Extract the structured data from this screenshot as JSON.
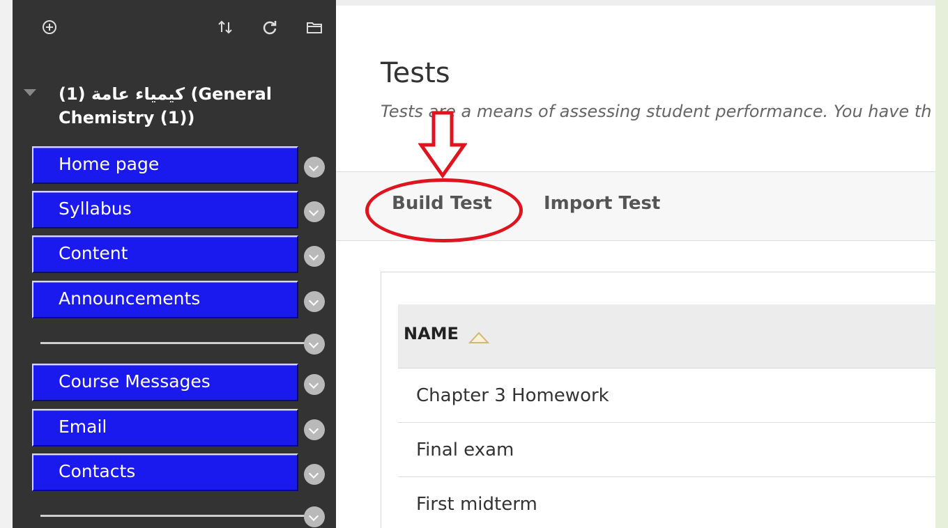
{
  "colors": {
    "sidebar_bg": "#333333",
    "nav_item_bg": "#1a1aee",
    "annotation_red": "#e0141e",
    "outer_bg": "#e6efd9"
  },
  "sidebar": {
    "toolbar_icons": [
      "add-circle-icon",
      "sort-arrows-icon",
      "refresh-icon",
      "folder-icon"
    ],
    "course_title": "كيمياء عامة (1) (General Chemistry (1))",
    "nav_groups": [
      [
        {
          "label": "Home page"
        },
        {
          "label": "Syllabus"
        },
        {
          "label": "Content"
        },
        {
          "label": "Announcements"
        }
      ],
      [
        {
          "label": "Course Messages"
        },
        {
          "label": "Email"
        },
        {
          "label": "Contacts"
        }
      ]
    ]
  },
  "main": {
    "title": "Tests",
    "description": "Tests are a means of assessing student performance. You have th",
    "actions": {
      "build_test": "Build Test",
      "import_test": "Import Test"
    },
    "list": {
      "header": "NAME",
      "rows": [
        {
          "name": "Chapter 3 Homework"
        },
        {
          "name": "Final exam"
        },
        {
          "name": "First midterm"
        }
      ]
    }
  }
}
